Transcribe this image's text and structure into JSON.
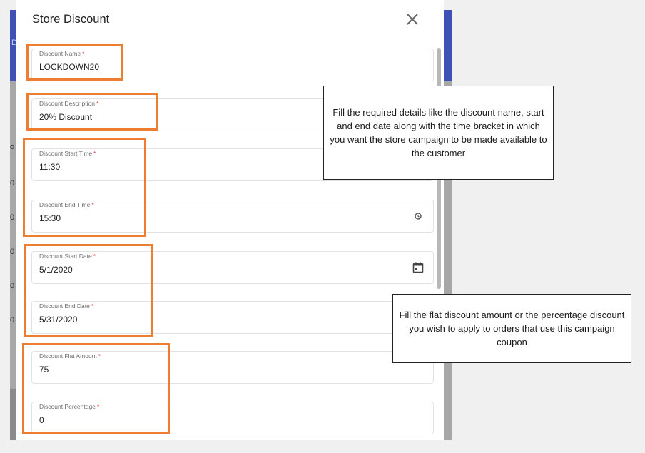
{
  "dialog": {
    "title": "Store Discount",
    "close_icon": "close-icon"
  },
  "fields": [
    {
      "id": "name",
      "label": "Discount Name",
      "required_mark": "*",
      "value": "LOCKDOWN20"
    },
    {
      "id": "description",
      "label": "Discount Description",
      "required_mark": "*",
      "value": "20% Discount"
    },
    {
      "id": "start_time",
      "label": "Discount Start Time",
      "required_mark": "*",
      "value": "11:30"
    },
    {
      "id": "end_time",
      "label": "Discount End Time",
      "required_mark": "*",
      "value": "15:30",
      "icon": "clock-icon"
    },
    {
      "id": "start_date",
      "label": "Discount Start Date",
      "required_mark": "*",
      "value": "5/1/2020",
      "icon": "calendar-icon"
    },
    {
      "id": "end_date",
      "label": "Discount End Date",
      "required_mark": "*",
      "value": "5/31/2020"
    },
    {
      "id": "flat_amount",
      "label": "Discount Flat Amount",
      "required_mark": "*",
      "value": "75"
    },
    {
      "id": "percentage",
      "label": "Discount Percentage",
      "required_mark": "*",
      "value": "0"
    }
  ],
  "callouts": {
    "details": "Fill the required details like the discount name, start and end date along with the time bracket in which you want the store campaign to be made available to the customer",
    "amount": "Fill the flat discount amount or the percentage discount you wish to apply to orders that use this campaign coupon"
  },
  "backdrop": {
    "header_glyph": "D",
    "column_glyphs": [
      "o",
      "0",
      "0",
      "0",
      "0",
      "0"
    ]
  },
  "colors": {
    "header_blue": "#3f51b5",
    "highlight_orange": "#ed7d31",
    "required_red": "#e53935"
  }
}
